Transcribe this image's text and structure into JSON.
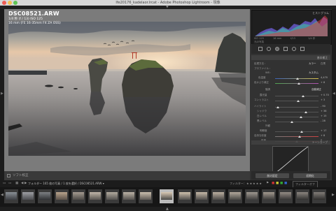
{
  "window": {
    "title": "lfe20176_kadelaor.lrcat - Adobe Photoshop Lightroom - 現像"
  },
  "photo_info": {
    "filename": "DSC08521.ARW",
    "exposure": "1/4 秒 (f / 13) ISO 125",
    "lens": "16 mm (FE 16-35mm F4 ZA OSS)"
  },
  "toolbar": {
    "soft_proof_label": "ソフト校正"
  },
  "right_panel": {
    "histogram_label": "ヒストグラム",
    "histogram_iso": "ISO 125",
    "histogram_focal": "16 mm",
    "histogram_aperture": "f/13",
    "histogram_shutter": "1/4 秒",
    "original_photo_label": "元の写真",
    "basic_label": "基本補正",
    "treatment_label": "処理方法 :",
    "treatment_color": "カラー",
    "treatment_bw": "白黒",
    "profile_label": "プロファイル :",
    "wb_label": "WB :",
    "wb_value": "カスタム",
    "temp_label": "色温度",
    "temp_value": "4,470",
    "tint_label": "色かぶり補正",
    "tint_value": "+ 8",
    "tone_label": "階調",
    "tone_auto": "自動補正",
    "exposure_label": "露光量",
    "exposure_value": "+ 0.70",
    "contrast_label": "コントラスト",
    "contrast_value": "+ 3",
    "highlights_label": "ハイライト",
    "highlights_value": "- 90",
    "shadows_label": "シャドウ",
    "shadows_value": "+ 38",
    "whites_label": "白レベル",
    "whites_value": "+ 15",
    "blacks_label": "黒レベル",
    "blacks_value": "- 28",
    "presence_label": "外観",
    "clarity_label": "明瞭度",
    "clarity_value": "+ 17",
    "vibrance_label": "自然な彩度",
    "vibrance_value": "+ 8",
    "saturation_label": "彩度",
    "saturation_value": "0",
    "tone_curve_label": "トーンカーブ",
    "prev_button": "前の設定",
    "reset_button": "初期化"
  },
  "filmstrip": {
    "path": "フォルダー 165 枚の写真 / 1 枚を選択 / DSC08521.ARW ▾",
    "filter_label": "フィルター：",
    "filter_value": "フィルターオフ"
  }
}
